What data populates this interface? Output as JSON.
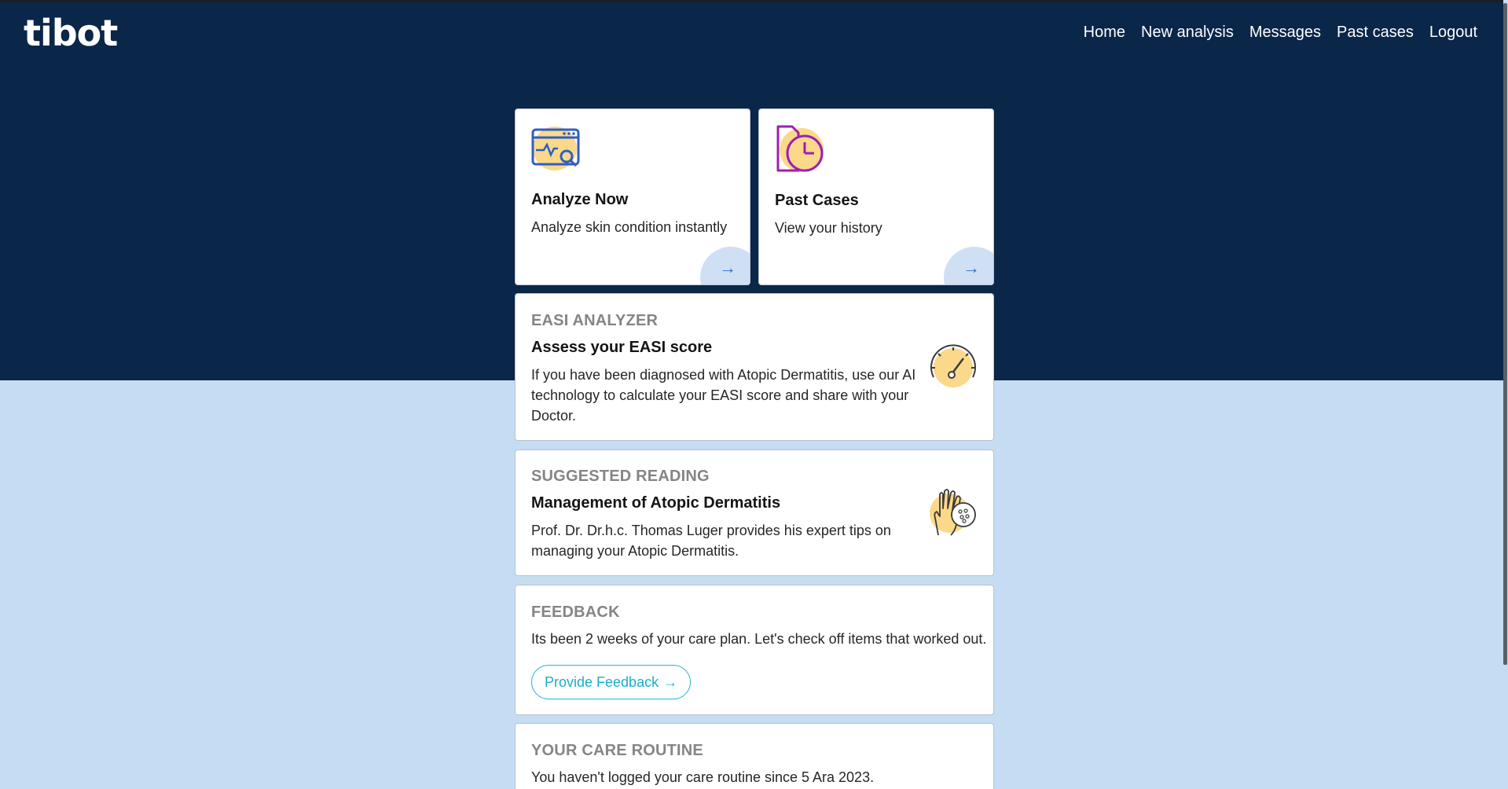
{
  "app": {
    "logo": "tibot"
  },
  "nav": {
    "items": [
      {
        "label": "Home"
      },
      {
        "label": "New analysis"
      },
      {
        "label": "Messages"
      },
      {
        "label": "Past cases"
      },
      {
        "label": "Logout"
      }
    ]
  },
  "tiles": {
    "analyze": {
      "title": "Analyze Now",
      "subtitle": "Analyze skin condition instantly"
    },
    "past": {
      "title": "Past Cases",
      "subtitle": "View your history"
    },
    "arrow_glyph": "→"
  },
  "easi": {
    "label": "EASI ANALYZER",
    "title": "Assess your EASI score",
    "body": "If you have been diagnosed with Atopic Dermatitis, use our AI technology to calculate your EASI score and share with your Doctor."
  },
  "reading": {
    "label": "SUGGESTED READING",
    "title": "Management of Atopic Dermatitis",
    "body": "Prof. Dr. Dr.h.c. Thomas Luger provides his expert tips on managing your Atopic Dermatitis."
  },
  "feedback": {
    "label": "FEEDBACK",
    "body": "Its been 2 weeks of your care plan. Let's check off items that worked out.",
    "button": "Provide Feedback",
    "button_arrow": "→"
  },
  "routine": {
    "label": "YOUR CARE ROUTINE",
    "body": "You haven't logged your care routine since 5 Ara 2023."
  },
  "colors": {
    "hero": "#0a2649",
    "page": "#c6dcf2",
    "accent_yellow": "#fbd98a",
    "icon_blue": "#2f5fc4",
    "icon_purple": "#9c1fb3",
    "feedback_teal": "#1aaecb"
  },
  "icons": {
    "analyze": "browser-scan-icon",
    "past": "document-clock-icon",
    "easi": "gauge-icon",
    "reading": "hand-skin-icon",
    "arrow": "arrow-right-icon"
  }
}
